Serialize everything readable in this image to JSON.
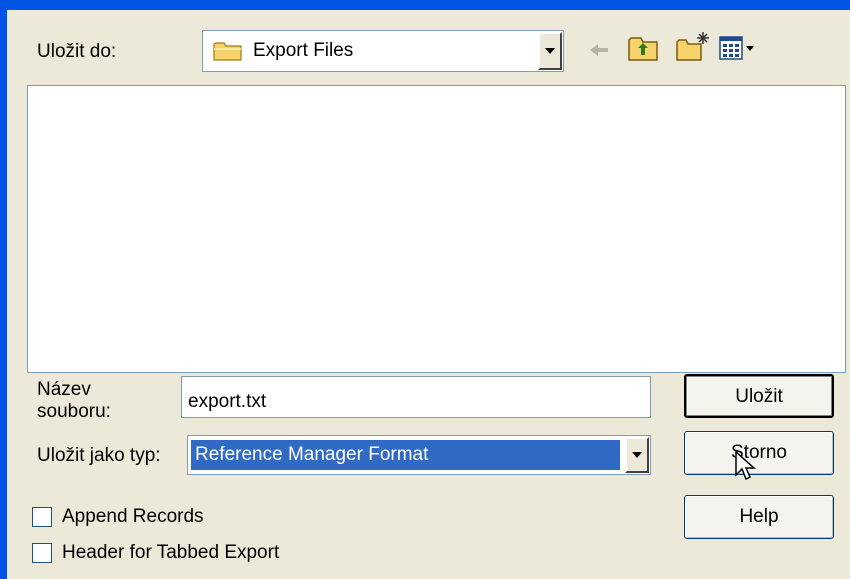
{
  "dialog": {
    "save_in_label": "Uložit do:",
    "save_in_value": "Export Files",
    "filename_label_line1": "Název",
    "filename_label_line2": "souboru:",
    "filename_value": "export.txt",
    "save_as_type_label": "Uložit jako typ:",
    "save_as_type_value": "Reference Manager Format",
    "checkboxes": [
      {
        "label": "Append Records",
        "checked": false
      },
      {
        "label": "Header for Tabbed Export",
        "checked": false
      }
    ],
    "buttons": {
      "save": "Uložit",
      "cancel": "Storno",
      "help": "Help"
    }
  },
  "toolbar_icons": [
    "back-arrow-icon",
    "up-folder-icon",
    "new-folder-icon",
    "view-menu-icon"
  ],
  "colors": {
    "titlebar": "#0054e3",
    "dialog_bg": "#ece9d8",
    "selection": "#316ac5",
    "field_border": "#7f9db9"
  }
}
